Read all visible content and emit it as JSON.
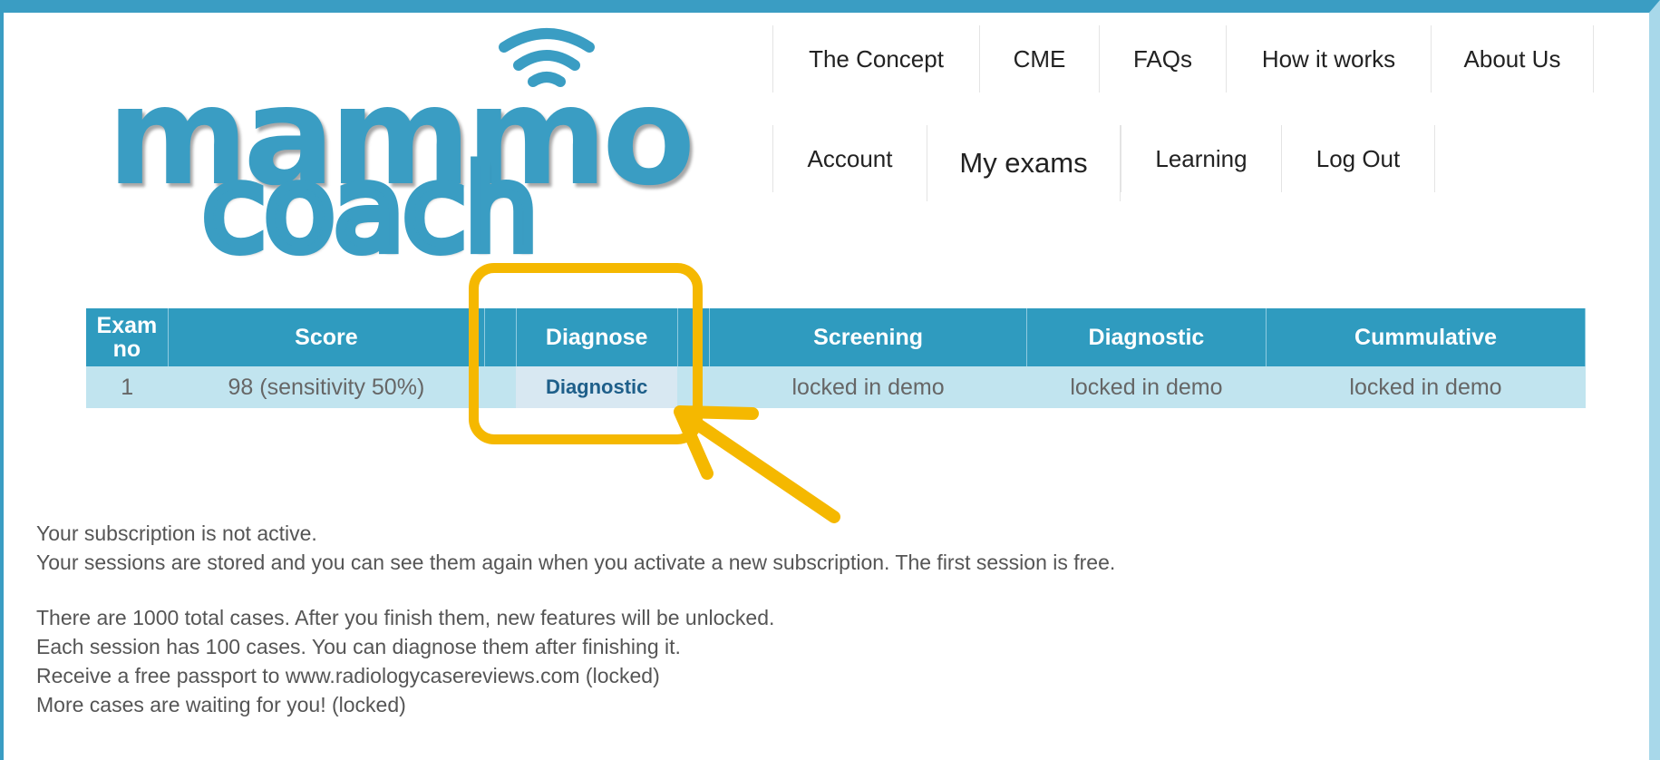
{
  "logo": {
    "line1": "mammo",
    "line2": "coach"
  },
  "nav": {
    "row1": [
      "The Concept",
      "CME",
      "FAQs",
      "How it works",
      "About Us"
    ],
    "row2": [
      "Account",
      "My exams",
      "Learning",
      "Log Out"
    ],
    "active": "My exams"
  },
  "table": {
    "headers": {
      "exam_no": "Exam no",
      "score": "Score",
      "diagnose": "Diagnose",
      "screening": "Screening",
      "diagnostic": "Diagnostic",
      "cummulative": "Cummulative"
    },
    "rows": [
      {
        "exam_no": "1",
        "score": "98 (sensitivity 50%)",
        "diagnose": "Diagnostic",
        "screening": "locked in demo",
        "diagnostic": "locked in demo",
        "cummulative": "locked in demo"
      }
    ]
  },
  "info": {
    "lines1": [
      "Your subscription is not active.",
      "Your sessions are stored and you can see them again when you activate a new subscription. The first session is free."
    ],
    "lines2": [
      "There are 1000 total cases. After you finish them, new features will be unlocked.",
      "Each session has 100 cases. You can diagnose them after finishing it.",
      "Receive a free passport to www.radiologycasereviews.com (locked)",
      "More cases are waiting for you! (locked)"
    ]
  },
  "colors": {
    "accent": "#2f9bbf",
    "highlight": "#f5b800",
    "row_bg": "#c1e4ef"
  }
}
